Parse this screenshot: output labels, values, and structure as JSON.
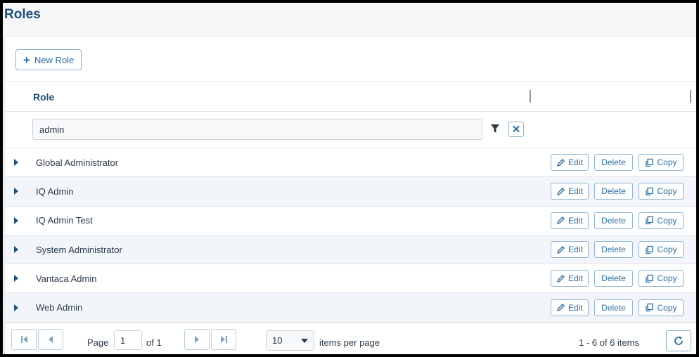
{
  "page": {
    "title": "Roles"
  },
  "toolbar": {
    "new_role_label": "New Role",
    "plus_glyph": "+"
  },
  "grid": {
    "column_role": "Role",
    "filter_value": "admin",
    "clear_glyph": "✕",
    "rows": [
      {
        "name": "Global Administrator"
      },
      {
        "name": "IQ Admin"
      },
      {
        "name": "IQ Admin Test"
      },
      {
        "name": "System Administrator"
      },
      {
        "name": "Vantaca Admin"
      },
      {
        "name": "Web Admin"
      }
    ],
    "actions": {
      "edit": "Edit",
      "delete": "Delete",
      "copy": "Copy"
    }
  },
  "pager": {
    "page_label": "Page",
    "page_value": "1",
    "of_label": "of 1",
    "page_size": "10",
    "items_per_page_label": "items per page",
    "summary": "1 - 6 of 6 items"
  },
  "icons": [
    "plus-icon",
    "filter-icon",
    "close-icon",
    "caret-right-icon",
    "pencil-icon",
    "copy-icon",
    "first-page-icon",
    "prev-page-icon",
    "next-page-icon",
    "last-page-icon",
    "dropdown-icon",
    "refresh-icon"
  ],
  "colors": {
    "title": "#1c4f7a",
    "accent": "#2a70a8",
    "row_alt": "#f2f6fa"
  }
}
